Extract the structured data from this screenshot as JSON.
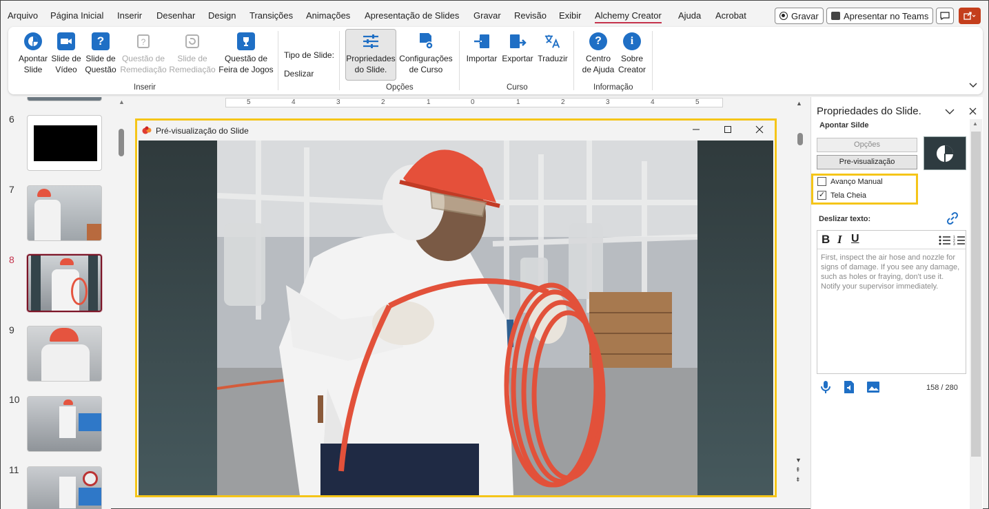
{
  "menubar": {
    "items": [
      "Arquivo",
      "Página Inicial",
      "Inserir",
      "Desenhar",
      "Design",
      "Transições",
      "Animações",
      "Apresentação de Slides",
      "Gravar",
      "Revisão",
      "Exibir",
      "Alchemy Creator",
      "Ajuda",
      "Acrobat"
    ],
    "active": "Alchemy Creator",
    "record_label": "Gravar",
    "teams_label": "Apresentar no Teams"
  },
  "ribbon": {
    "inserir": {
      "buttons": [
        {
          "line1": "Apontar",
          "line2": "Slide",
          "icon": "pie-chart-icon"
        },
        {
          "line1": "Slide de",
          "line2": "Vídeo",
          "icon": "video-camera-icon"
        },
        {
          "line1": "Slide de",
          "line2": "Questão",
          "icon": "question-icon"
        },
        {
          "line1": "Questão de",
          "line2": "Remediação",
          "icon": "remediation-question-icon"
        },
        {
          "line1": "Slide de",
          "line2": "Remediação",
          "icon": "remediation-slide-icon"
        },
        {
          "line1": "Questão de",
          "line2": "Feira de Jogos",
          "icon": "trophy-icon"
        }
      ],
      "tipo_label": "Tipo de Slide:",
      "deslizar_label": "Deslizar",
      "group_label": "Inserir"
    },
    "opcoes": {
      "buttons": [
        {
          "line1": "Propriedades",
          "line2": "do Slide.",
          "icon": "sliders-icon"
        },
        {
          "line1": "Configurações",
          "line2": "de Curso",
          "icon": "course-settings-icon"
        }
      ],
      "group_label": "Opções"
    },
    "curso": {
      "buttons": [
        {
          "line1": "Importar",
          "icon": "import-icon"
        },
        {
          "line1": "Exportar",
          "icon": "export-icon"
        },
        {
          "line1": "Traduzir",
          "icon": "translate-icon"
        }
      ],
      "group_label": "Curso"
    },
    "informacao": {
      "buttons": [
        {
          "line1": "Centro",
          "line2": "de Ajuda",
          "icon": "help-icon"
        },
        {
          "line1": "Sobre",
          "line2": "Creator",
          "icon": "info-icon"
        }
      ],
      "group_label": "Informação"
    }
  },
  "slides": {
    "numbers": [
      "6",
      "7",
      "8",
      "9",
      "10",
      "11"
    ],
    "active": "8"
  },
  "ruler": {
    "ticks": [
      "5",
      "4",
      "3",
      "2",
      "1",
      "0",
      "1",
      "2",
      "3",
      "4",
      "5"
    ]
  },
  "preview": {
    "title": "Pré-visualização do Slide"
  },
  "properties": {
    "title": "Propriedades do Slide.",
    "subtitle": "Apontar Silde",
    "options_button": "Opções",
    "preview_button": "Pre-visualização",
    "manual_advance": "Avanço Manual",
    "manual_advance_checked": false,
    "fullscreen": "Tela Cheia",
    "fullscreen_checked": true,
    "slide_text_label": "Deslizar texto:",
    "editor_text": "First, inspect the air hose and nozzle for signs of damage. If you see any damage, such as holes or fraying, don't use it. Notify your supervisor immediately.",
    "char_count": "158 / 280"
  },
  "colors": {
    "accent_blue": "#1f6fc5",
    "highlight_yellow": "#f5c518",
    "active_tab_underline": "#c4314b"
  }
}
